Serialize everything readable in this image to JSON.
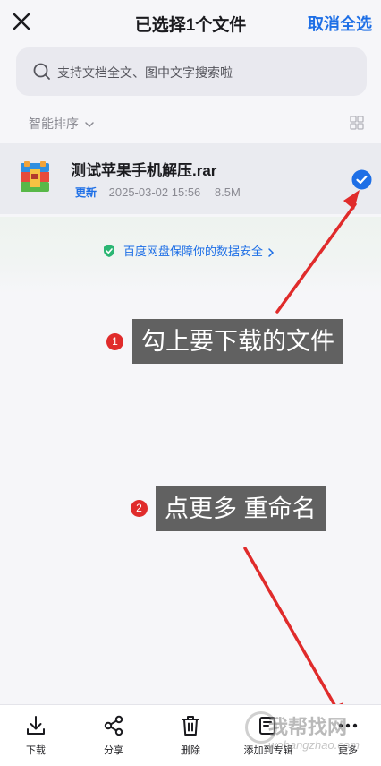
{
  "header": {
    "title": "已选择1个文件",
    "cancel_label": "取消全选"
  },
  "search": {
    "placeholder": "支持文档全文、图中文字搜索啦"
  },
  "sort": {
    "label": "智能排序"
  },
  "file": {
    "name": "测试苹果手机解压.rar",
    "tag": "更新",
    "date": "2025-03-02 15:56",
    "size": "8.5M",
    "selected": true
  },
  "security": {
    "label": "百度网盘保障你的数据安全",
    "color": "#1e6fe6"
  },
  "annotations": [
    {
      "number": "1",
      "text": "勾上要下载的文件"
    },
    {
      "number": "2",
      "text": "点更多 重命名"
    }
  ],
  "toolbar": {
    "items": [
      {
        "label": "下载",
        "icon": "download-icon"
      },
      {
        "label": "分享",
        "icon": "share-icon"
      },
      {
        "label": "删除",
        "icon": "trash-icon"
      },
      {
        "label": "添加到专辑",
        "icon": "add-to-album-icon"
      },
      {
        "label": "更多",
        "icon": "more-icon"
      }
    ]
  },
  "watermark": {
    "text": "我帮找网",
    "url": "wobangzhao.com"
  },
  "colors": {
    "accent": "#1e6fe6",
    "annotation_bg": "#616161",
    "arrow": "#e02b2b"
  }
}
